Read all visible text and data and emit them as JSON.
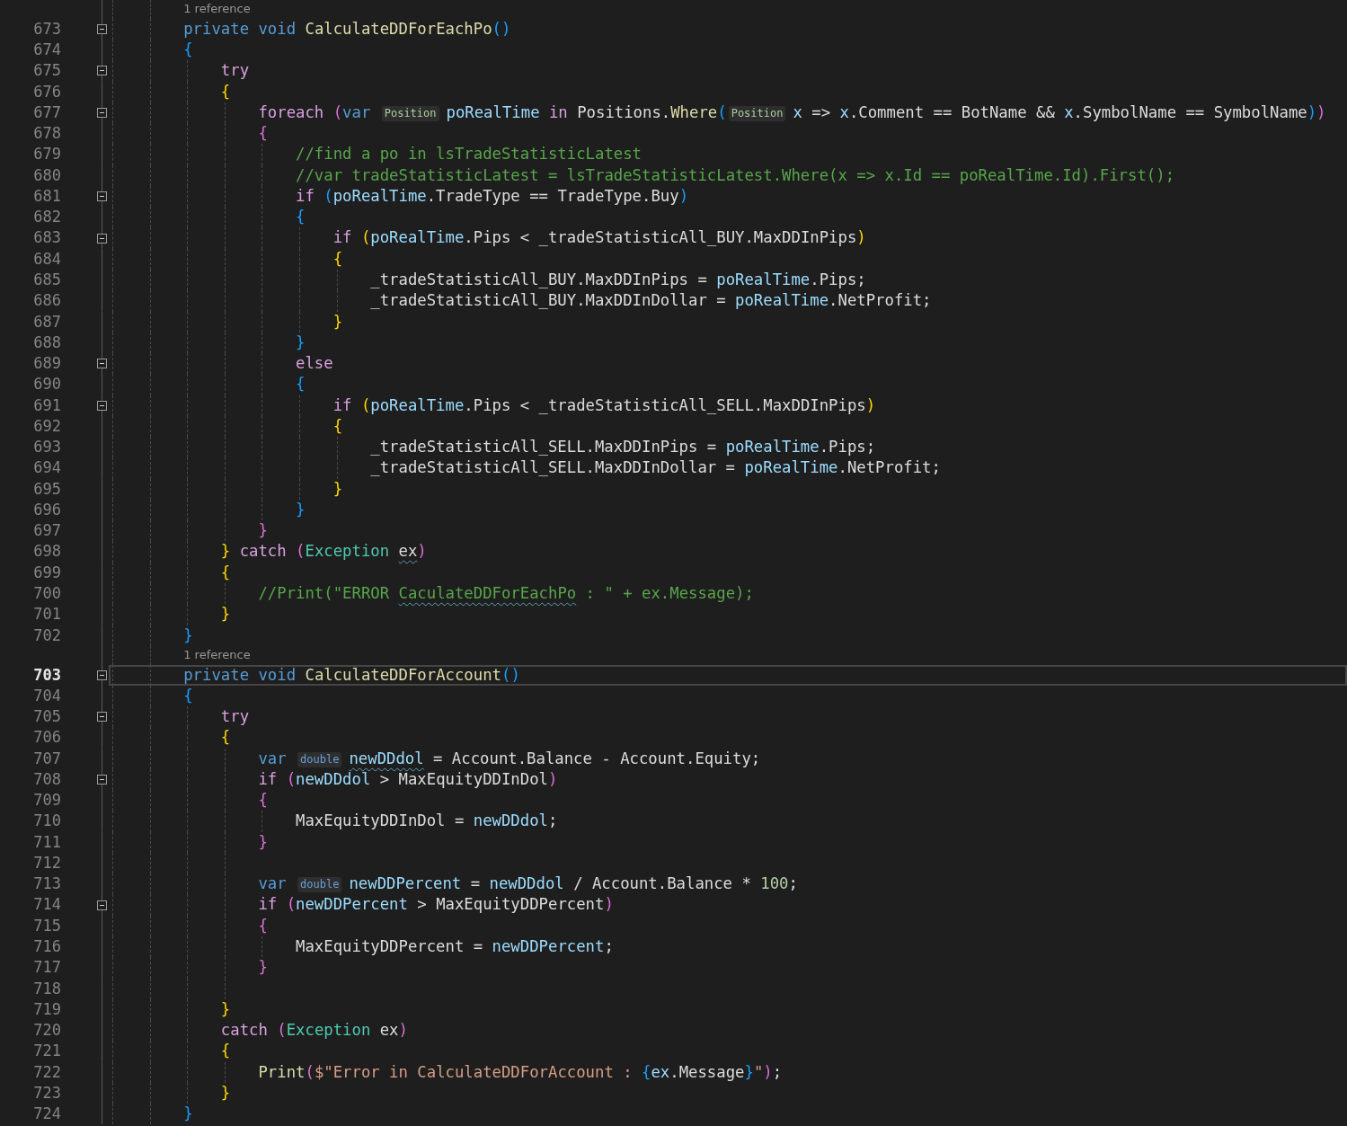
{
  "lines": [
    {
      "kind": "codelens",
      "text": "1 reference"
    },
    {
      "kind": "code",
      "number": "673",
      "current": false,
      "expanded": true,
      "tokens": [
        {
          "text": "private void ",
          "kind": "kw"
        },
        {
          "text": "CalculateDDForEachPo",
          "kind": "fn"
        },
        {
          "text": "()",
          "kind": "b3"
        }
      ]
    },
    {
      "kind": "code",
      "number": "674",
      "current": false,
      "tokens": [
        {
          "text": "{",
          "kind": "b3"
        }
      ],
      "children": [
        {
          "kind": "code",
          "number": "675",
          "current": false,
          "expanded": true,
          "tokens": [
            {
              "text": "try",
              "kind": "ctl"
            }
          ]
        },
        {
          "kind": "code",
          "number": "676",
          "current": false,
          "tokens": [
            {
              "text": "{",
              "kind": "b1"
            }
          ],
          "children": [
            {
              "kind": "code",
              "number": "677",
              "current": false,
              "expanded": true,
              "tokens": [
                {
                  "text": "foreach ",
                  "kind": "ctl"
                },
                {
                  "text": "(",
                  "kind": "b2"
                },
                {
                  "text": "var ",
                  "kind": "kw"
                },
                {
                  "text": "Position",
                  "kind": "hint_class"
                },
                {
                  "text": "poRealTime",
                  "kind": "var"
                },
                {
                  "text": " in ",
                  "kind": "ctl"
                },
                {
                  "text": "Positions.",
                  "kind": "plain"
                },
                {
                  "text": "Where",
                  "kind": "fn"
                },
                {
                  "text": "(",
                  "kind": "b3"
                },
                {
                  "text": "Position",
                  "kind": "hint_class"
                },
                {
                  "text": "x",
                  "kind": "var"
                },
                {
                  "text": " => ",
                  "kind": "plain"
                },
                {
                  "text": "x",
                  "kind": "var"
                },
                {
                  "text": ".Comment == BotName && ",
                  "kind": "plain"
                },
                {
                  "text": "x",
                  "kind": "var"
                },
                {
                  "text": ".SymbolName == SymbolName",
                  "kind": "plain"
                },
                {
                  "text": ")",
                  "kind": "b3"
                },
                {
                  "text": ")",
                  "kind": "b2"
                }
              ]
            },
            {
              "kind": "code",
              "number": "678",
              "current": false,
              "tokens": [
                {
                  "text": "{",
                  "kind": "b2"
                }
              ],
              "children": [
                {
                  "kind": "code",
                  "number": "679",
                  "current": false,
                  "tokens": [
                    {
                      "text": "//find a po in lsTradeStatisticLatest",
                      "kind": "comment"
                    }
                  ]
                },
                {
                  "kind": "code",
                  "number": "680",
                  "current": false,
                  "tokens": [
                    {
                      "text": "//var tradeStatisticLatest = lsTradeStatisticLatest.Where(x => x.Id == poRealTime.Id).First();",
                      "kind": "comment"
                    }
                  ]
                },
                {
                  "kind": "code",
                  "number": "681",
                  "current": false,
                  "expanded": true,
                  "tokens": [
                    {
                      "text": "if ",
                      "kind": "ctl"
                    },
                    {
                      "text": "(",
                      "kind": "b3"
                    },
                    {
                      "text": "poRealTime",
                      "kind": "var"
                    },
                    {
                      "text": ".TradeType == TradeType.Buy",
                      "kind": "plain"
                    },
                    {
                      "text": ")",
                      "kind": "b3"
                    }
                  ]
                },
                {
                  "kind": "code",
                  "number": "682",
                  "current": false,
                  "tokens": [
                    {
                      "text": "{",
                      "kind": "b3"
                    }
                  ],
                  "children": [
                    {
                      "kind": "code",
                      "number": "683",
                      "current": false,
                      "expanded": true,
                      "tokens": [
                        {
                          "text": "if ",
                          "kind": "ctl"
                        },
                        {
                          "text": "(",
                          "kind": "b1"
                        },
                        {
                          "text": "poRealTime",
                          "kind": "var"
                        },
                        {
                          "text": ".Pips < _tradeStatisticAll_BUY.MaxDDInPips",
                          "kind": "plain"
                        },
                        {
                          "text": ")",
                          "kind": "b1"
                        }
                      ]
                    },
                    {
                      "kind": "code",
                      "number": "684",
                      "current": false,
                      "tokens": [
                        {
                          "text": "{",
                          "kind": "b1"
                        }
                      ],
                      "children": [
                        {
                          "kind": "code",
                          "number": "685",
                          "current": false,
                          "tokens": [
                            {
                              "text": "_tradeStatisticAll_BUY.MaxDDInPips = ",
                              "kind": "plain"
                            },
                            {
                              "text": "poRealTime",
                              "kind": "var"
                            },
                            {
                              "text": ".Pips;",
                              "kind": "plain"
                            }
                          ]
                        },
                        {
                          "kind": "code",
                          "number": "686",
                          "current": false,
                          "tokens": [
                            {
                              "text": "_tradeStatisticAll_BUY.MaxDDInDollar = ",
                              "kind": "plain"
                            },
                            {
                              "text": "poRealTime",
                              "kind": "var"
                            },
                            {
                              "text": ".NetProfit;",
                              "kind": "plain"
                            }
                          ]
                        }
                      ]
                    },
                    {
                      "kind": "code",
                      "number": "687",
                      "current": false,
                      "tokens": [
                        {
                          "text": "}",
                          "kind": "b1"
                        }
                      ]
                    }
                  ]
                },
                {
                  "kind": "code",
                  "number": "688",
                  "current": false,
                  "tokens": [
                    {
                      "text": "}",
                      "kind": "b3"
                    }
                  ]
                },
                {
                  "kind": "code",
                  "number": "689",
                  "current": false,
                  "expanded": true,
                  "tokens": [
                    {
                      "text": "else",
                      "kind": "ctl"
                    }
                  ]
                },
                {
                  "kind": "code",
                  "number": "690",
                  "current": false,
                  "tokens": [
                    {
                      "text": "{",
                      "kind": "b3"
                    }
                  ],
                  "children": [
                    {
                      "kind": "code",
                      "number": "691",
                      "current": false,
                      "expanded": true,
                      "tokens": [
                        {
                          "text": "if ",
                          "kind": "ctl"
                        },
                        {
                          "text": "(",
                          "kind": "b1"
                        },
                        {
                          "text": "poRealTime",
                          "kind": "var"
                        },
                        {
                          "text": ".Pips < _tradeStatisticAll_SELL.MaxDDInPips",
                          "kind": "plain"
                        },
                        {
                          "text": ")",
                          "kind": "b1"
                        }
                      ]
                    },
                    {
                      "kind": "code",
                      "number": "692",
                      "current": false,
                      "tokens": [
                        {
                          "text": "{",
                          "kind": "b1"
                        }
                      ],
                      "children": [
                        {
                          "kind": "code",
                          "number": "693",
                          "current": false,
                          "tokens": [
                            {
                              "text": "_tradeStatisticAll_SELL.MaxDDInPips = ",
                              "kind": "plain"
                            },
                            {
                              "text": "poRealTime",
                              "kind": "var"
                            },
                            {
                              "text": ".Pips;",
                              "kind": "plain"
                            }
                          ]
                        },
                        {
                          "kind": "code",
                          "number": "694",
                          "current": false,
                          "tokens": [
                            {
                              "text": "_tradeStatisticAll_SELL.MaxDDInDollar = ",
                              "kind": "plain"
                            },
                            {
                              "text": "poRealTime",
                              "kind": "var"
                            },
                            {
                              "text": ".NetProfit;",
                              "kind": "plain"
                            }
                          ]
                        }
                      ]
                    },
                    {
                      "kind": "code",
                      "number": "695",
                      "current": false,
                      "tokens": [
                        {
                          "text": "}",
                          "kind": "b1"
                        }
                      ]
                    }
                  ]
                },
                {
                  "kind": "code",
                  "number": "696",
                  "current": false,
                  "tokens": [
                    {
                      "text": "}",
                      "kind": "b3"
                    }
                  ]
                }
              ]
            },
            {
              "kind": "code",
              "number": "697",
              "current": false,
              "tokens": [
                {
                  "text": "}",
                  "kind": "b2"
                }
              ]
            }
          ]
        },
        {
          "kind": "code",
          "number": "698",
          "current": false,
          "tokens": [
            {
              "text": "}",
              "kind": "b1"
            },
            {
              "text": " catch ",
              "kind": "ctl"
            },
            {
              "text": "(",
              "kind": "b2"
            },
            {
              "text": "Exception ",
              "kind": "type"
            },
            {
              "text": "ex",
              "kind": "plain",
              "squiggle": true
            },
            {
              "text": ")",
              "kind": "b2"
            }
          ]
        },
        {
          "kind": "code",
          "number": "699",
          "current": false,
          "tokens": [
            {
              "text": "{",
              "kind": "b1"
            }
          ],
          "children": [
            {
              "kind": "code",
              "number": "700",
              "current": false,
              "tokens": [
                {
                  "text": "//Print(\"ERROR ",
                  "kind": "comment"
                },
                {
                  "text": "CaculateDDForEachPo",
                  "kind": "comment",
                  "squiggle": true
                },
                {
                  "text": " : \" + ex.Message);",
                  "kind": "comment"
                }
              ]
            }
          ]
        },
        {
          "kind": "code",
          "number": "701",
          "current": false,
          "tokens": [
            {
              "text": "}",
              "kind": "b1"
            }
          ]
        }
      ]
    },
    {
      "kind": "code",
      "number": "702",
      "current": false,
      "tokens": [
        {
          "text": "}",
          "kind": "b3"
        }
      ]
    },
    {
      "kind": "codelens",
      "text": "1 reference"
    },
    {
      "kind": "code",
      "number": "703",
      "current": true,
      "expanded": true,
      "tokens": [
        {
          "text": "private void ",
          "kind": "kw"
        },
        {
          "text": "CalculateDDForAccount",
          "kind": "fn"
        },
        {
          "text": "()",
          "kind": "b3"
        }
      ]
    },
    {
      "kind": "code",
      "number": "704",
      "current": false,
      "tokens": [
        {
          "text": "{",
          "kind": "b3"
        }
      ],
      "children": [
        {
          "kind": "code",
          "number": "705",
          "current": false,
          "expanded": true,
          "tokens": [
            {
              "text": "try",
              "kind": "ctl"
            }
          ]
        },
        {
          "kind": "code",
          "number": "706",
          "current": false,
          "tokens": [
            {
              "text": "{",
              "kind": "b1"
            }
          ],
          "children": [
            {
              "kind": "code",
              "number": "707",
              "current": false,
              "tokens": [
                {
                  "text": "var ",
                  "kind": "kw"
                },
                {
                  "text": "double",
                  "kind": "hint_keyword"
                },
                {
                  "text": "newDDdol",
                  "kind": "var",
                  "squiggle": true
                },
                {
                  "text": " = Account.Balance - Account.Equity;",
                  "kind": "plain"
                }
              ]
            },
            {
              "kind": "code",
              "number": "708",
              "current": false,
              "expanded": true,
              "tokens": [
                {
                  "text": "if ",
                  "kind": "ctl"
                },
                {
                  "text": "(",
                  "kind": "b2"
                },
                {
                  "text": "newDDdol",
                  "kind": "var"
                },
                {
                  "text": " > MaxEquityDDInDol",
                  "kind": "plain"
                },
                {
                  "text": ")",
                  "kind": "b2"
                }
              ]
            },
            {
              "kind": "code",
              "number": "709",
              "current": false,
              "tokens": [
                {
                  "text": "{",
                  "kind": "b2"
                }
              ],
              "children": [
                {
                  "kind": "code",
                  "number": "710",
                  "current": false,
                  "tokens": [
                    {
                      "text": "MaxEquityDDInDol = ",
                      "kind": "plain"
                    },
                    {
                      "text": "newDDdol",
                      "kind": "var"
                    },
                    {
                      "text": ";",
                      "kind": "plain"
                    }
                  ]
                }
              ]
            },
            {
              "kind": "code",
              "number": "711",
              "current": false,
              "tokens": [
                {
                  "text": "}",
                  "kind": "b2"
                }
              ]
            },
            {
              "kind": "code",
              "number": "712",
              "current": false
            },
            {
              "kind": "code",
              "number": "713",
              "current": false,
              "tokens": [
                {
                  "text": "var ",
                  "kind": "kw"
                },
                {
                  "text": "double",
                  "kind": "hint_keyword"
                },
                {
                  "text": "newDDPercent",
                  "kind": "var"
                },
                {
                  "text": " = ",
                  "kind": "plain"
                },
                {
                  "text": "newDDdol",
                  "kind": "var"
                },
                {
                  "text": " / Account.Balance * ",
                  "kind": "plain"
                },
                {
                  "text": "100",
                  "kind": "num"
                },
                {
                  "text": ";",
                  "kind": "plain"
                }
              ]
            },
            {
              "kind": "code",
              "number": "714",
              "current": false,
              "expanded": true,
              "tokens": [
                {
                  "text": "if ",
                  "kind": "ctl"
                },
                {
                  "text": "(",
                  "kind": "b2"
                },
                {
                  "text": "newDDPercent",
                  "kind": "var"
                },
                {
                  "text": " > MaxEquityDDPercent",
                  "kind": "plain"
                },
                {
                  "text": ")",
                  "kind": "b2"
                }
              ]
            },
            {
              "kind": "code",
              "number": "715",
              "current": false,
              "tokens": [
                {
                  "text": "{",
                  "kind": "b2"
                }
              ],
              "children": [
                {
                  "kind": "code",
                  "number": "716",
                  "current": false,
                  "tokens": [
                    {
                      "text": "MaxEquityDDPercent = ",
                      "kind": "plain"
                    },
                    {
                      "text": "newDDPercent",
                      "kind": "var"
                    },
                    {
                      "text": ";",
                      "kind": "plain"
                    }
                  ]
                }
              ]
            },
            {
              "kind": "code",
              "number": "717",
              "current": false,
              "tokens": [
                {
                  "text": "}",
                  "kind": "b2"
                }
              ]
            },
            {
              "kind": "code",
              "number": "718",
              "current": false
            }
          ]
        },
        {
          "kind": "code",
          "number": "719",
          "current": false,
          "tokens": [
            {
              "text": "}",
              "kind": "b1"
            }
          ]
        },
        {
          "kind": "code",
          "number": "720",
          "current": false,
          "tokens": [
            {
              "text": "catch ",
              "kind": "ctl"
            },
            {
              "text": "(",
              "kind": "b2"
            },
            {
              "text": "Exception",
              "kind": "type"
            },
            {
              "text": " ex",
              "kind": "plain"
            },
            {
              "text": ")",
              "kind": "b2"
            }
          ]
        },
        {
          "kind": "code",
          "number": "721",
          "current": false,
          "tokens": [
            {
              "text": "{",
              "kind": "b1"
            }
          ],
          "children": [
            {
              "kind": "code",
              "number": "722",
              "current": false,
              "tokens": [
                {
                  "text": "Print",
                  "kind": "fn"
                },
                {
                  "text": "(",
                  "kind": "b2"
                },
                {
                  "text": "$\"Error in CalculateDDForAccount : ",
                  "kind": "str"
                },
                {
                  "text": "{",
                  "kind": "b3"
                },
                {
                  "text": "ex",
                  "kind": "var"
                },
                {
                  "text": ".Message",
                  "kind": "plain"
                },
                {
                  "text": "}",
                  "kind": "b3"
                },
                {
                  "text": "\"",
                  "kind": "str"
                },
                {
                  "text": ")",
                  "kind": "b2"
                },
                {
                  "text": ";",
                  "kind": "plain"
                }
              ]
            }
          ]
        },
        {
          "kind": "code",
          "number": "723",
          "current": false,
          "tokens": [
            {
              "text": "}",
              "kind": "b1"
            }
          ]
        }
      ]
    },
    {
      "kind": "code",
      "number": "724",
      "current": false,
      "tokens": [
        {
          "text": "}",
          "kind": "b3"
        }
      ]
    }
  ]
}
